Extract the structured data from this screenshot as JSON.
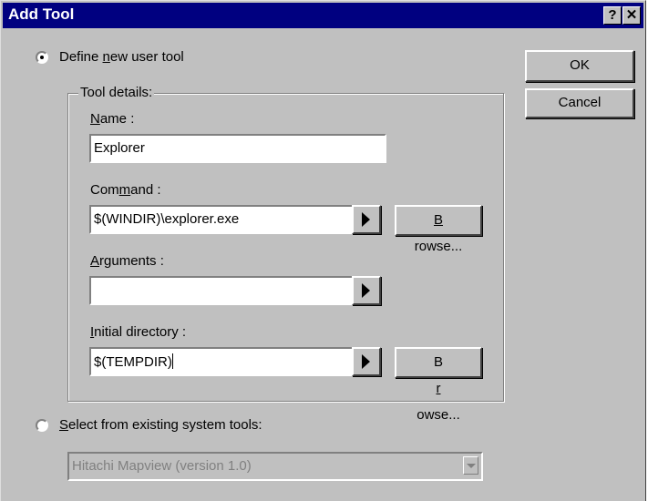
{
  "window": {
    "title": "Add Tool",
    "help_glyph": "?",
    "close_glyph": "✕"
  },
  "buttons": {
    "ok": "OK",
    "cancel": "Cancel"
  },
  "mode": {
    "define_new": {
      "label_pre": "Define ",
      "label_key": "n",
      "label_post": "ew user tool",
      "selected": true
    },
    "select_existing": {
      "label_pre": "",
      "label_key": "S",
      "label_post": "elect from existing system tools:",
      "selected": false
    }
  },
  "tool_details": {
    "caption": "Tool details:",
    "name": {
      "label_key": "N",
      "label_post": "ame :",
      "value": "Explorer"
    },
    "command": {
      "label_pre": "Com",
      "label_key": "m",
      "label_post": "and :",
      "value": "$(WINDIR)\\explorer.exe",
      "browse_key": "B",
      "browse_post": "rowse..."
    },
    "arguments": {
      "label_key": "A",
      "label_post": "rguments :",
      "value": ""
    },
    "initial_directory": {
      "label_key": "I",
      "label_post": "nitial directory :",
      "value": "$(TEMPDIR)",
      "browse_pre": "B",
      "browse_key": "r",
      "browse_post": "owse..."
    }
  },
  "system_tools": {
    "selected_value": "Hitachi Mapview  (version 1.0)",
    "enabled": false
  }
}
